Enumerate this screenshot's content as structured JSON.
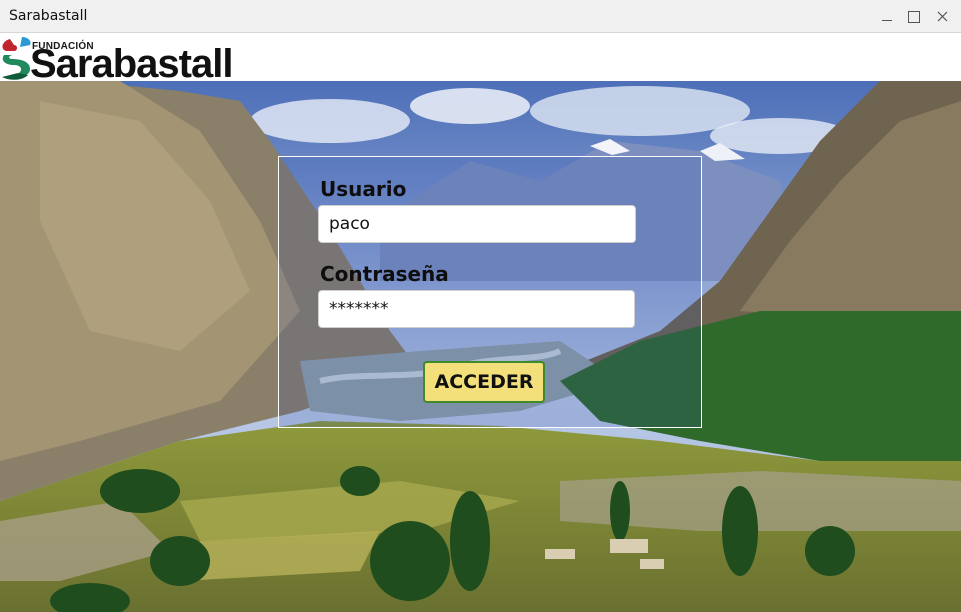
{
  "window": {
    "title": "Sarabastall"
  },
  "logo": {
    "prefix": "FUNDACIÓN",
    "name": "Sarabastall"
  },
  "login": {
    "user_label": "Usuario",
    "user_value": "paco",
    "password_label": "Contraseña",
    "password_value": "*******",
    "submit_label": "ACCEDER"
  },
  "colors": {
    "button_bg": "#f3e07a",
    "button_border": "#3f8a2c",
    "panel_border": "#ffffff",
    "titlebar_bg": "#f0f0f0"
  },
  "icons": {
    "minimize": "minimize-icon",
    "maximize": "maximize-icon",
    "close": "close-icon"
  }
}
